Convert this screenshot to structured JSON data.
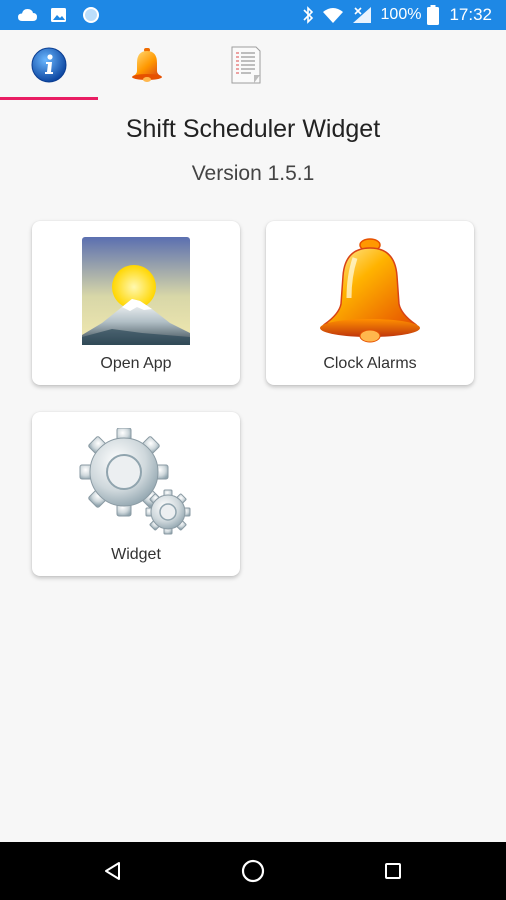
{
  "status_bar": {
    "battery": "100%",
    "time": "17:32"
  },
  "tabs": [
    {
      "name": "info",
      "icon": "info-icon",
      "selected": true
    },
    {
      "name": "alarms",
      "icon": "bell-icon",
      "selected": false
    },
    {
      "name": "log",
      "icon": "document-icon",
      "selected": false
    }
  ],
  "header": {
    "title": "Shift Scheduler Widget",
    "version": "Version 1.5.1"
  },
  "cards": [
    {
      "label": "Open App",
      "icon": "mountain-icon"
    },
    {
      "label": "Clock Alarms",
      "icon": "bell-icon"
    },
    {
      "label": "Widget",
      "icon": "gears-icon"
    }
  ],
  "colors": {
    "status_bar": "#1e88e5",
    "tab_indicator": "#e91e63",
    "background": "#f7f7f7",
    "nav_bar": "#000000"
  }
}
